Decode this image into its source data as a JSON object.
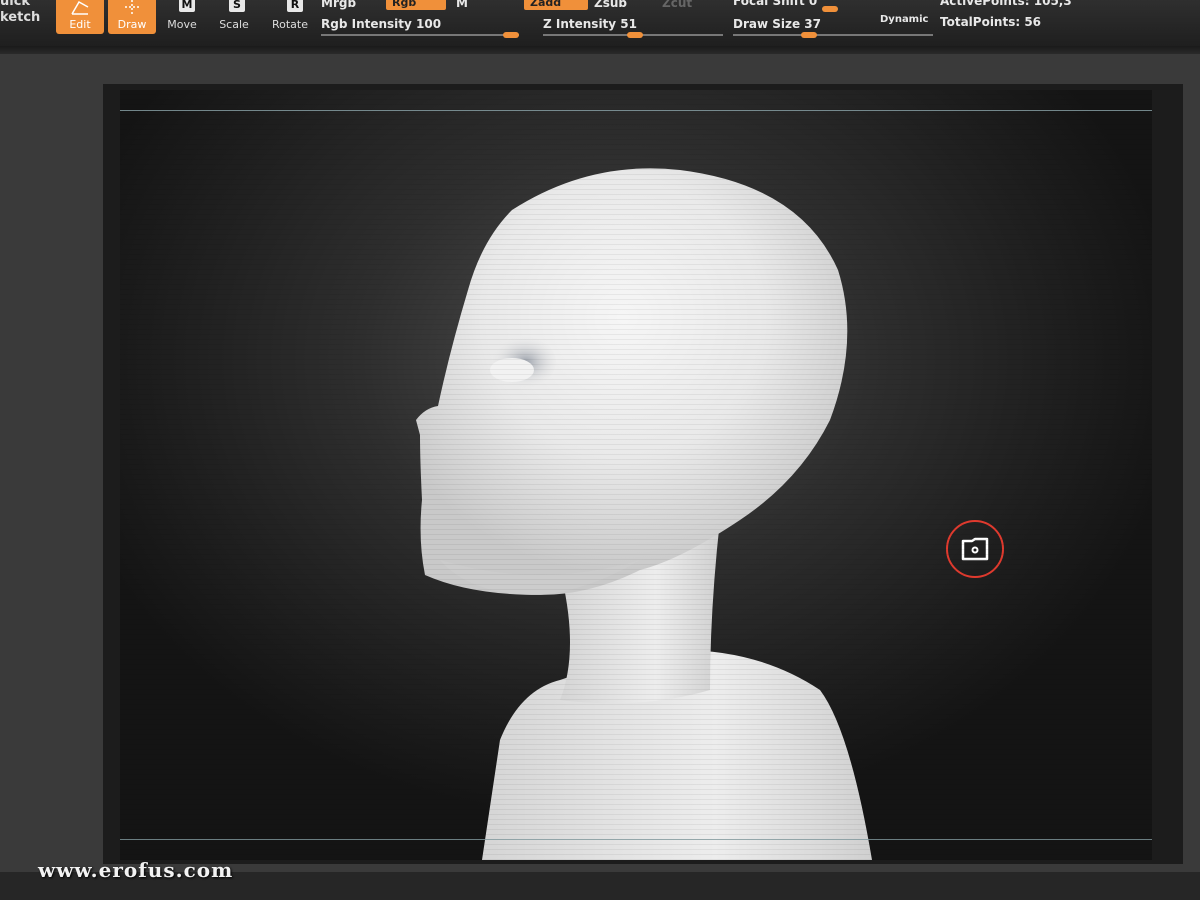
{
  "toolbar": {
    "quick_sketch": [
      "uick",
      "ketch"
    ],
    "buttons": {
      "edit": "Edit",
      "draw": "Draw",
      "move": "Move",
      "scale": "Scale",
      "rotate": "Rotate"
    },
    "keys": {
      "move": "M",
      "scale": "S",
      "rotate": "R"
    },
    "mrgb": "Mrgb",
    "rgb": "Rgb",
    "m": "M",
    "zadd": "Zadd",
    "zsub": "Zsub",
    "zcut": "Zcut",
    "rgb_intensity": "Rgb  Intensity 100",
    "z_intensity": "Z Intensity 51",
    "focal_shift": "Focal Shift 0",
    "draw_size": "Draw  Size 37",
    "dynamic": "Dynamic",
    "active_points": "ActivePoints: 105,3",
    "total_points": "TotalPoints: 56"
  },
  "sliders": {
    "rgb_intensity": 1.0,
    "z_intensity": 0.51,
    "draw_size": 0.37
  },
  "viewport": {
    "floor_icon": "floor-grid-icon"
  },
  "watermark": "www.erofus.com",
  "colors": {
    "accent": "#f0903a",
    "background": "#3a3a3a",
    "viewport": "#1c1c1c",
    "highlight_ring": "#e03a2e"
  }
}
